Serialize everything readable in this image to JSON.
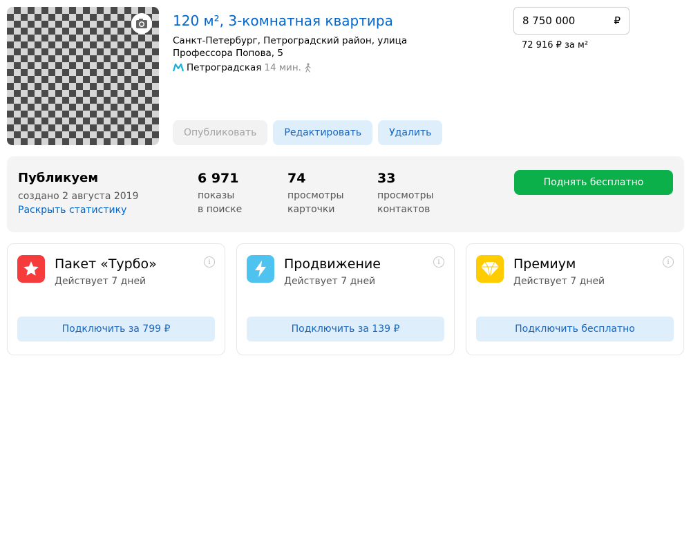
{
  "listing": {
    "title": "120 м², 3-комнатная квартира",
    "address": "Санкт-Петербург, Петроградский район, улица Профессора Попова, 5",
    "metro": {
      "station": "Петроградская",
      "time": "14 мин.",
      "icon": "metro-icon",
      "color": "#1bb0d8"
    },
    "price": {
      "value": "8 750 000",
      "currency": "₽",
      "per_sqm": "72 916 ₽ за м²"
    },
    "actions": {
      "publish": "Опубликовать",
      "edit": "Редактировать",
      "delete": "Удалить"
    }
  },
  "stats": {
    "status": "Публикуем",
    "created": "создано 2 августа 2019",
    "expand": "Раскрыть статистику",
    "items": [
      {
        "value": "6 971",
        "label1": "показы",
        "label2": "в поиске"
      },
      {
        "value": "74",
        "label1": "просмотры",
        "label2": "карточки"
      },
      {
        "value": "33",
        "label1": "просмотры",
        "label2": "контактов"
      }
    ],
    "raise_button": "Поднять бесплатно",
    "raise_color": "#0bb04a"
  },
  "services": [
    {
      "name": "Пакет «Турбо»",
      "duration": "Действует 7 дней",
      "button": "Подключить за 799 ₽",
      "icon": "star-icon",
      "color": "#f53b3b"
    },
    {
      "name": "Продвижение",
      "duration": "Действует 7 дней",
      "button": "Подключить за 139 ₽",
      "icon": "lightning-icon",
      "color": "#4fc3f0"
    },
    {
      "name": "Премиум",
      "duration": "Действует 7 дней",
      "button": "Подключить бесплатно",
      "icon": "diamond-icon",
      "color": "#ffcc00"
    }
  ]
}
